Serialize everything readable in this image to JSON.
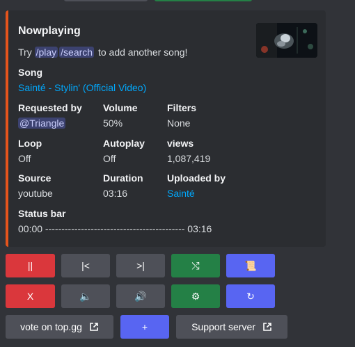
{
  "embed": {
    "title": "Nowplaying",
    "desc_prefix": "Try",
    "cmd_play": "/play",
    "cmd_search": "/search",
    "desc_suffix": "to add another song!",
    "accent_color": "#e5541c",
    "song": {
      "name": "Song",
      "value": "Sainté - Stylin' (Official Video)"
    },
    "requested_by": {
      "name": "Requested by",
      "value": "@Triangle"
    },
    "volume": {
      "name": "Volume",
      "value": "50%"
    },
    "filters": {
      "name": "Filters",
      "value": "None"
    },
    "loop": {
      "name": "Loop",
      "value": "Off"
    },
    "autoplay": {
      "name": "Autoplay",
      "value": "Off"
    },
    "views": {
      "name": "views",
      "value": "1,087,419"
    },
    "source": {
      "name": "Source",
      "value": "youtube"
    },
    "duration": {
      "name": "Duration",
      "value": "03:16"
    },
    "uploaded_by": {
      "name": "Uploaded by",
      "value": "Sainté"
    },
    "status_bar": {
      "name": "Status bar",
      "value": "00:00 ------------------------------------------- 03:16"
    }
  },
  "buttons": {
    "row1": [
      "||",
      "|<",
      ">|",
      "⤭",
      "📜"
    ],
    "row2": [
      "X",
      "🔈",
      "🔊",
      "⚙",
      "↻"
    ],
    "row3": [
      "vote on top.gg",
      "+",
      "Support server"
    ]
  },
  "icons": {
    "shuffle": "shuffle-icon",
    "queue": "scroll-icon",
    "volume_down": "speaker-low-icon",
    "volume_up": "speaker-high-icon",
    "settings": "gear-icon",
    "loop": "refresh-icon",
    "external": "external-link-icon"
  }
}
